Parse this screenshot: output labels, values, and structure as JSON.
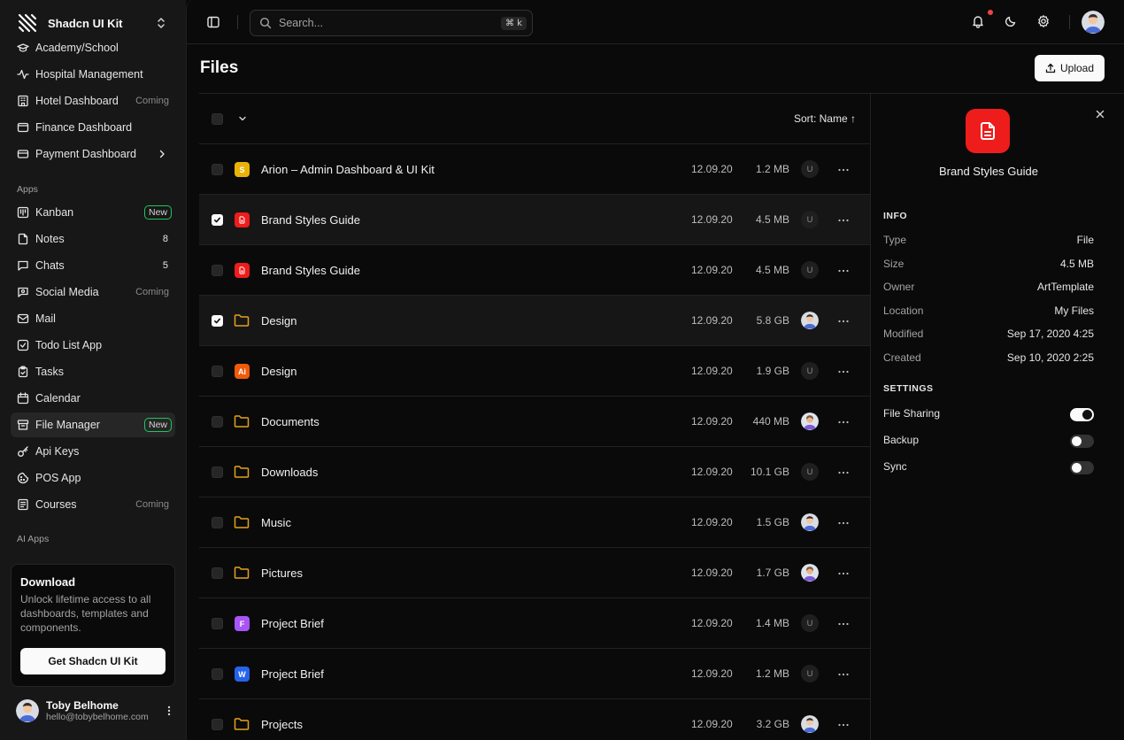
{
  "brand": {
    "name": "Shadcn UI Kit"
  },
  "sidebar": {
    "top_items": [
      {
        "label": "Academy/School",
        "icon": "graduation-cap-icon"
      },
      {
        "label": "Hospital Management",
        "icon": "activity-icon"
      },
      {
        "label": "Hotel Dashboard",
        "icon": "hotel-icon",
        "tag": "Coming"
      },
      {
        "label": "Finance Dashboard",
        "icon": "wallet-icon"
      },
      {
        "label": "Payment Dashboard",
        "icon": "credit-card-icon",
        "has_submenu": true
      }
    ],
    "apps_label": "Apps",
    "apps": [
      {
        "label": "Kanban",
        "icon": "kanban-icon",
        "badge": "New"
      },
      {
        "label": "Notes",
        "icon": "note-icon",
        "count": "8"
      },
      {
        "label": "Chats",
        "icon": "chat-icon",
        "count": "5"
      },
      {
        "label": "Social Media",
        "icon": "social-icon",
        "tag": "Coming"
      },
      {
        "label": "Mail",
        "icon": "mail-icon"
      },
      {
        "label": "Todo List App",
        "icon": "checkbox-icon"
      },
      {
        "label": "Tasks",
        "icon": "clipboard-icon"
      },
      {
        "label": "Calendar",
        "icon": "calendar-icon"
      },
      {
        "label": "File Manager",
        "icon": "archive-icon",
        "badge": "New",
        "active": true
      },
      {
        "label": "Api Keys",
        "icon": "key-icon"
      },
      {
        "label": "POS App",
        "icon": "cookie-icon"
      },
      {
        "label": "Courses",
        "icon": "book-icon",
        "tag": "Coming"
      }
    ],
    "ai_apps_label": "AI Apps",
    "promo": {
      "title": "Download",
      "text": "Unlock lifetime access to all dashboards, templates and components.",
      "button": "Get Shadcn UI Kit"
    },
    "user": {
      "name": "Toby Belhome",
      "email": "hello@tobybelhome.com"
    }
  },
  "topbar": {
    "search_placeholder": "Search...",
    "shortcut": "⌘ k"
  },
  "page": {
    "title": "Files",
    "upload_label": "Upload"
  },
  "list": {
    "sort_label": "Sort: Name ↑",
    "rows": [
      {
        "name": "Arion – Admin Dashboard & UI Kit",
        "date": "12.09.20",
        "size": "1.2 MB",
        "owner": "U",
        "kind": "file",
        "letter": "S",
        "color": "#eab308",
        "checked": false
      },
      {
        "name": "Brand Styles Guide",
        "date": "12.09.20",
        "size": "4.5 MB",
        "owner": "U",
        "kind": "doc",
        "color": "#ef1c1c",
        "checked": true
      },
      {
        "name": "Brand Styles Guide",
        "date": "12.09.20",
        "size": "4.5 MB",
        "owner": "U",
        "kind": "doc",
        "color": "#ef1c1c",
        "checked": false
      },
      {
        "name": "Design",
        "date": "12.09.20",
        "size": "5.8 GB",
        "owner": "avatar",
        "kind": "folder",
        "checked": true
      },
      {
        "name": "Design",
        "date": "12.09.20",
        "size": "1.9 GB",
        "owner": "U",
        "kind": "file",
        "letter": "Ai",
        "color": "#f05a0a",
        "checked": false
      },
      {
        "name": "Documents",
        "date": "12.09.20",
        "size": "440 MB",
        "owner": "avatar2",
        "kind": "folder",
        "checked": false
      },
      {
        "name": "Downloads",
        "date": "12.09.20",
        "size": "10.1 GB",
        "owner": "U",
        "kind": "folder",
        "checked": false
      },
      {
        "name": "Music",
        "date": "12.09.20",
        "size": "1.5 GB",
        "owner": "avatar",
        "kind": "folder",
        "checked": false
      },
      {
        "name": "Pictures",
        "date": "12.09.20",
        "size": "1.7 GB",
        "owner": "avatar2",
        "kind": "folder",
        "checked": false
      },
      {
        "name": "Project Brief",
        "date": "12.09.20",
        "size": "1.4 MB",
        "owner": "U",
        "kind": "file",
        "letter": "F",
        "color": "#a855f7",
        "checked": false
      },
      {
        "name": "Project Brief",
        "date": "12.09.20",
        "size": "1.2 MB",
        "owner": "U",
        "kind": "file",
        "letter": "W",
        "color": "#2563eb",
        "checked": false
      },
      {
        "name": "Projects",
        "date": "12.09.20",
        "size": "3.2 GB",
        "owner": "avatar",
        "kind": "folder",
        "checked": false
      }
    ]
  },
  "details": {
    "title": "Brand Styles Guide",
    "info_label": "INFO",
    "info": [
      {
        "key": "Type",
        "value": "File"
      },
      {
        "key": "Size",
        "value": "4.5 MB"
      },
      {
        "key": "Owner",
        "value": "ArtTemplate"
      },
      {
        "key": "Location",
        "value": "My Files"
      },
      {
        "key": "Modified",
        "value": "Sep 17, 2020 4:25"
      },
      {
        "key": "Created",
        "value": "Sep 10, 2020 2:25"
      }
    ],
    "settings_label": "SETTINGS",
    "settings": [
      {
        "label": "File Sharing",
        "on": true
      },
      {
        "label": "Backup",
        "on": false
      },
      {
        "label": "Sync",
        "on": false
      }
    ]
  },
  "colors": {
    "folder": "#e4a11b",
    "new_badge_border": "#22c55e",
    "notification": "#ef4444",
    "doc_red": "#ef1c1c"
  }
}
